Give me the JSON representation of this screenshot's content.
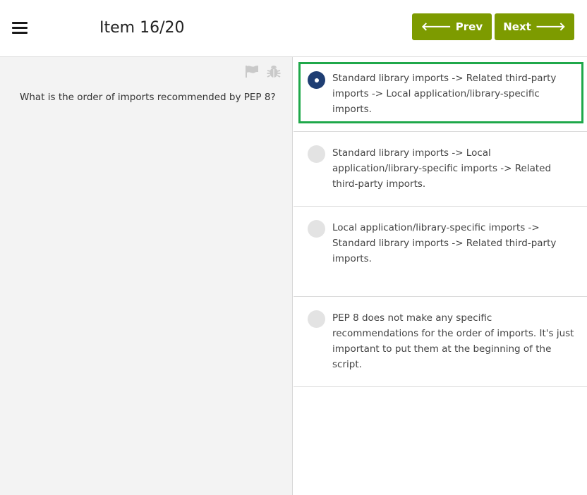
{
  "header": {
    "menu_icon": "hamburger-menu-icon",
    "item_counter": "Item 16/20",
    "prev_label": "Prev",
    "next_label": "Next",
    "prev_icon": "arrow-left-icon",
    "next_icon": "arrow-right-icon",
    "button_color": "#7d9b00"
  },
  "question": {
    "text": "What is the order of imports recommended by PEP 8?",
    "tools": [
      "flag-icon",
      "bug-icon"
    ]
  },
  "options": [
    {
      "text": "Standard library imports -> Related third-party imports -> Local application/library-specific imports.",
      "selected": true
    },
    {
      "text": "Standard library imports -> Local application/library-specific imports -> Related third-party imports.",
      "selected": false
    },
    {
      "text": "Local application/library-specific imports -> Standard library imports -> Related third-party imports.",
      "selected": false
    },
    {
      "text": "PEP 8 does not make any specific recommendations for the order of imports. It's just important to put them at the beginning of the script.",
      "selected": false
    }
  ],
  "colors": {
    "selected_radio": "#1f3e73",
    "highlight_border": "#1fa84a",
    "left_panel_bg": "#f3f3f3"
  }
}
